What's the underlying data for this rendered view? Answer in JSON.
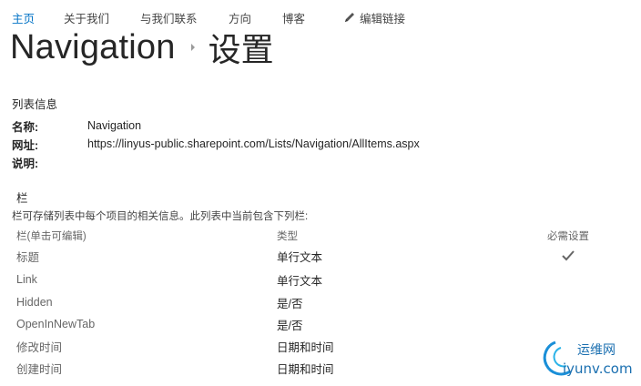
{
  "topnav": {
    "items": [
      "主页",
      "关于我们",
      "与我们联系",
      "方向",
      "博客"
    ],
    "edit_links": "编辑链接"
  },
  "title": {
    "site": "Navigation",
    "page": "设置"
  },
  "list_info": {
    "heading": "列表信息",
    "name_label": "名称:",
    "name_value": "Navigation",
    "url_label": "网址:",
    "url_value": "https://linyus-public.sharepoint.com/Lists/Navigation/AllItems.aspx",
    "desc_label": "说明:"
  },
  "columns": {
    "heading": "栏",
    "description": "栏可存储列表中每个项目的相关信息。此列表中当前包含下列栏:",
    "headers": {
      "name": "栏(单击可编辑)",
      "type": "类型",
      "required": "必需设置"
    },
    "rows": [
      {
        "name": "标题",
        "type": "单行文本",
        "required": true
      },
      {
        "name": "Link",
        "type": "单行文本",
        "required": false
      },
      {
        "name": "Hidden",
        "type": "是/否",
        "required": false
      },
      {
        "name": "OpenInNewTab",
        "type": "是/否",
        "required": false
      },
      {
        "name": "修改时间",
        "type": "日期和时间",
        "required": false
      },
      {
        "name": "创建时间",
        "type": "日期和时间",
        "required": false
      }
    ]
  },
  "watermark": {
    "cn": "运维网",
    "en": "iyunv.com"
  },
  "colors": {
    "accent": "#0072c6",
    "text": "#262626",
    "muted": "#666666"
  }
}
